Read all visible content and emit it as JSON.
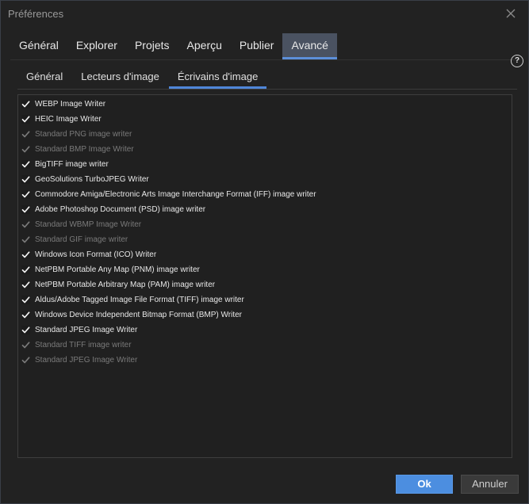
{
  "window": {
    "title": "Préférences"
  },
  "tabs": [
    "Général",
    "Explorer",
    "Projets",
    "Aperçu",
    "Publier",
    "Avancé"
  ],
  "active_tab": "Avancé",
  "subtabs": [
    "Général",
    "Lecteurs d'image",
    "Écrivains d'image"
  ],
  "active_subtab": "Écrivains d'image",
  "help": {
    "symbol": "?"
  },
  "writers": [
    {
      "label": "WEBP Image Writer",
      "checked": true,
      "enabled": true
    },
    {
      "label": "HEIC Image Writer",
      "checked": true,
      "enabled": true
    },
    {
      "label": "Standard PNG image writer",
      "checked": true,
      "enabled": false
    },
    {
      "label": "Standard BMP Image Writer",
      "checked": true,
      "enabled": false
    },
    {
      "label": "BigTIFF image writer",
      "checked": true,
      "enabled": true
    },
    {
      "label": "GeoSolutions TurboJPEG Writer",
      "checked": true,
      "enabled": true
    },
    {
      "label": "Commodore Amiga/Electronic Arts Image Interchange Format (IFF) image writer",
      "checked": true,
      "enabled": true
    },
    {
      "label": "Adobe Photoshop Document (PSD) image writer",
      "checked": true,
      "enabled": true
    },
    {
      "label": "Standard WBMP Image Writer",
      "checked": true,
      "enabled": false
    },
    {
      "label": "Standard GIF image writer",
      "checked": true,
      "enabled": false
    },
    {
      "label": "Windows Icon Format (ICO) Writer",
      "checked": true,
      "enabled": true
    },
    {
      "label": "NetPBM Portable Any Map (PNM) image writer",
      "checked": true,
      "enabled": true
    },
    {
      "label": "NetPBM Portable Arbitrary Map (PAM) image writer",
      "checked": true,
      "enabled": true
    },
    {
      "label": "Aldus/Adobe Tagged Image File Format (TIFF) image writer",
      "checked": true,
      "enabled": true
    },
    {
      "label": "Windows Device Independent Bitmap Format (BMP) Writer",
      "checked": true,
      "enabled": true
    },
    {
      "label": "Standard JPEG Image Writer",
      "checked": true,
      "enabled": true
    },
    {
      "label": "Standard TIFF image writer",
      "checked": true,
      "enabled": false
    },
    {
      "label": "Standard JPEG Image Writer",
      "checked": true,
      "enabled": false
    }
  ],
  "buttons": {
    "ok": "Ok",
    "cancel": "Annuler"
  },
  "colors": {
    "accent": "#4c8ee0",
    "active_tab_bg": "#4a5261",
    "background": "#222222"
  },
  "icons": {
    "close": "close-icon",
    "help": "help-icon",
    "check": "checkmark-icon"
  }
}
